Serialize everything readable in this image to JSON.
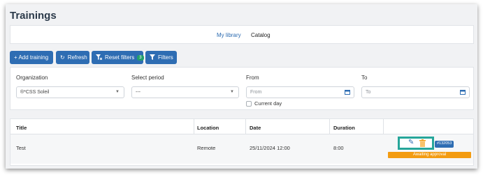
{
  "page": {
    "title": "Trainings"
  },
  "tabs": [
    {
      "label": "My library",
      "active": true
    },
    {
      "label": "Catalog",
      "active": false
    }
  ],
  "toolbar": {
    "add_label": "+ Add training",
    "refresh_label": "Refresh",
    "reset_label": "Reset filters",
    "reset_count": "3",
    "filters_label": "Filters"
  },
  "filters": {
    "organization": {
      "label": "Organization",
      "value": "®*CSS Soleil"
    },
    "period": {
      "label": "Select period",
      "value": "---"
    },
    "from": {
      "label": "From",
      "placeholder": "From"
    },
    "to": {
      "label": "To",
      "placeholder": "To"
    },
    "current_day_label": "Current day"
  },
  "table": {
    "columns": [
      "Title",
      "Location",
      "Date",
      "Duration"
    ],
    "rows": [
      {
        "title": "Test",
        "location": "Remote",
        "date": "25/11/2024 12:00",
        "duration": "8:00",
        "id_badge": "#132053",
        "status": "Awaiting approval"
      }
    ]
  },
  "colors": {
    "primary": "#2e6db3",
    "badge_green": "#22a06b",
    "status_orange": "#f39c12",
    "highlight_teal": "#26a69a"
  },
  "icons": [
    "refresh-icon",
    "filter-reset-icon",
    "filter-icon",
    "chevron-down-icon",
    "calendar-icon",
    "edit-pencil-icon",
    "trash-icon"
  ]
}
